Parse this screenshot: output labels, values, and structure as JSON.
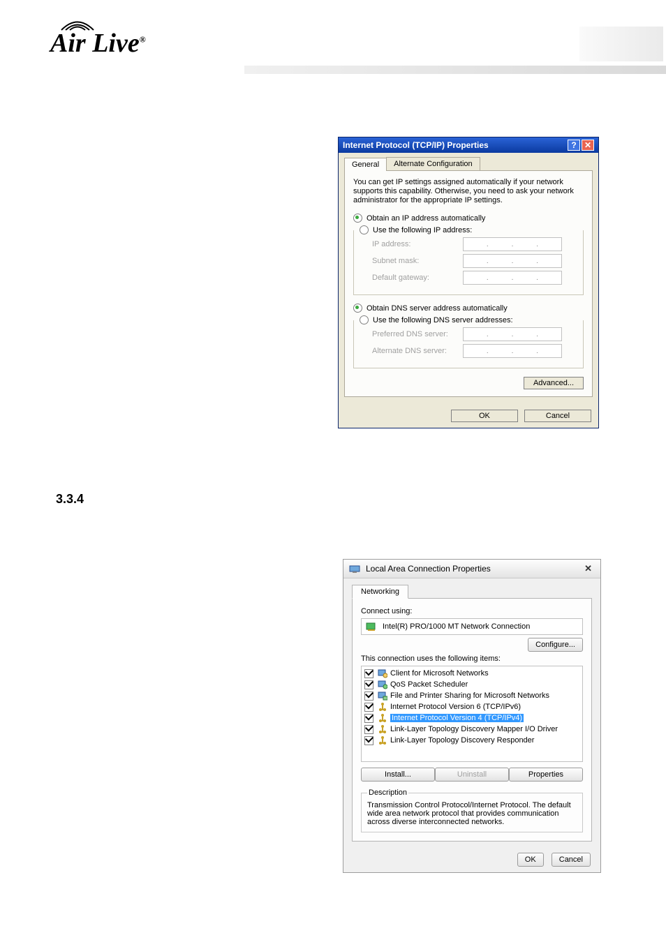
{
  "header": {
    "logo_text": "Air Live",
    "logo_reg": "®"
  },
  "section_number": "3.3.4",
  "dlg1": {
    "title": "Internet Protocol (TCP/IP) Properties",
    "tabs": {
      "general": "General",
      "alt": "Alternate Configuration"
    },
    "desc": "You can get IP settings assigned automatically if your network supports this capability. Otherwise, you need to ask your network administrator for the appropriate IP settings.",
    "radio_auto_ip": "Obtain an IP address automatically",
    "radio_manual_ip": "Use the following IP address:",
    "label_ip": "IP address:",
    "label_subnet": "Subnet mask:",
    "label_gateway": "Default gateway:",
    "radio_auto_dns": "Obtain DNS server address automatically",
    "radio_manual_dns": "Use the following DNS server addresses:",
    "label_pref_dns": "Preferred DNS server:",
    "label_alt_dns": "Alternate DNS server:",
    "btn_advanced": "Advanced...",
    "btn_ok": "OK",
    "btn_cancel": "Cancel"
  },
  "dlg2": {
    "title": "Local Area Connection Properties",
    "tab": "Networking",
    "connect_using": "Connect using:",
    "adapter": "Intel(R) PRO/1000 MT Network Connection",
    "btn_configure": "Configure...",
    "uses_label": "This connection uses the following items:",
    "items": [
      {
        "label": "Client for Microsoft Networks",
        "checked": true,
        "selected": false,
        "icon": "client"
      },
      {
        "label": "QoS Packet Scheduler",
        "checked": true,
        "selected": false,
        "icon": "qos"
      },
      {
        "label": "File and Printer Sharing for Microsoft Networks",
        "checked": true,
        "selected": false,
        "icon": "share"
      },
      {
        "label": "Internet Protocol Version 6 (TCP/IPv6)",
        "checked": true,
        "selected": false,
        "icon": "proto"
      },
      {
        "label": "Internet Protocol Version 4 (TCP/IPv4)",
        "checked": true,
        "selected": true,
        "icon": "proto"
      },
      {
        "label": "Link-Layer Topology Discovery Mapper I/O Driver",
        "checked": true,
        "selected": false,
        "icon": "proto"
      },
      {
        "label": "Link-Layer Topology Discovery Responder",
        "checked": true,
        "selected": false,
        "icon": "proto"
      }
    ],
    "btn_install": "Install...",
    "btn_uninstall": "Uninstall",
    "btn_properties": "Properties",
    "desc_legend": "Description",
    "desc_text": "Transmission Control Protocol/Internet Protocol. The default wide area network protocol that provides communication across diverse interconnected networks.",
    "btn_ok": "OK",
    "btn_cancel": "Cancel"
  }
}
